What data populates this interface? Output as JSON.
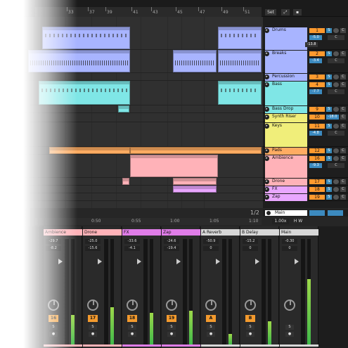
{
  "ruler": {
    "labels": [
      "33",
      "37",
      "39",
      "41",
      "43",
      "45",
      "47",
      "49",
      "51"
    ],
    "set_label": "Set"
  },
  "ruler2": {
    "labels": [
      "0:50",
      "0:55",
      "1:00",
      "1:05",
      "1:10"
    ],
    "zoom": "1.00x",
    "hw": "H W",
    "page": "1/2"
  },
  "tracks": [
    {
      "name": "Drums",
      "num": "1",
      "vol": "-5.0",
      "ctl": "C",
      "color": "#a8b4ff",
      "tall": true,
      "extra_vol": "-13.8"
    },
    {
      "name": "Breaks",
      "num": "2",
      "vol": "-3.4",
      "ctl": "C",
      "color": "#a8b4ff",
      "tall": true
    },
    {
      "name": "Percussion",
      "num": "3",
      "color": "#a8b4ff"
    },
    {
      "name": "Bass",
      "num": "4",
      "vol": "-7.7",
      "ctl": "C",
      "color": "#7fe6e6",
      "tall": true
    },
    {
      "name": "Bass Drop",
      "num": "9",
      "color": "#7fe6e6"
    },
    {
      "name": "Synth Riser",
      "num": "10",
      "vol": "-18.0",
      "color": "#f0ee7a"
    },
    {
      "name": "Keys",
      "num": "11",
      "vol": "-4.8",
      "ctl": "C",
      "color": "#f0ee7a",
      "tall": true
    },
    {
      "name": "Pads",
      "num": "12",
      "color": "#ffac62"
    },
    {
      "name": "Ambience",
      "num": "16",
      "vol": "-9.3",
      "ctl": "C",
      "color": "#ffb2b8",
      "tall": true
    },
    {
      "name": "Drone",
      "num": "17",
      "color": "#ffb2b8"
    },
    {
      "name": "FX",
      "num": "18",
      "color": "#e9a7ff"
    },
    {
      "name": "Zap",
      "num": "19",
      "color": "#e9a7ff"
    }
  ],
  "main": {
    "label": "Main"
  },
  "mixer": [
    {
      "title": "Ambience",
      "db1": "-29.7",
      "db2": "-8.2",
      "num": "16",
      "color": "#ffb2b8",
      "level": 0.28
    },
    {
      "title": "Drone",
      "db1": "-25.0",
      "db2": "-15.6",
      "num": "17",
      "color": "#ffb2b8",
      "level": 0.35
    },
    {
      "title": "FX",
      "db1": "-33.6",
      "db2": "-4.1",
      "num": "18",
      "color": "#e07de8",
      "level": 0.3
    },
    {
      "title": "Zap",
      "db1": "-24.6",
      "db2": "-19.4",
      "num": "19",
      "color": "#e07de8",
      "level": 0.32
    },
    {
      "title": "A Reverb",
      "db1": "-50.9",
      "db2": "0",
      "num": "A",
      "color": "#d7d7d7",
      "level": 0.1
    },
    {
      "title": "B Delay",
      "db1": "-15.2",
      "db2": "0",
      "num": "B",
      "color": "#d7d7d7",
      "level": 0.22
    },
    {
      "title": "Main",
      "db1": "-0.30",
      "db2": "0",
      "num": "",
      "color": "#d7d7d7",
      "level": 0.62
    }
  ],
  "mixer_buttons": {
    "solo": "S"
  },
  "colors": {
    "blue": "#a8b4ff",
    "cyan": "#7fe6e6",
    "yellow": "#f0ee7a",
    "orange": "#ffac62",
    "pink": "#ffb2b8",
    "purple": "#e9a7ff"
  }
}
